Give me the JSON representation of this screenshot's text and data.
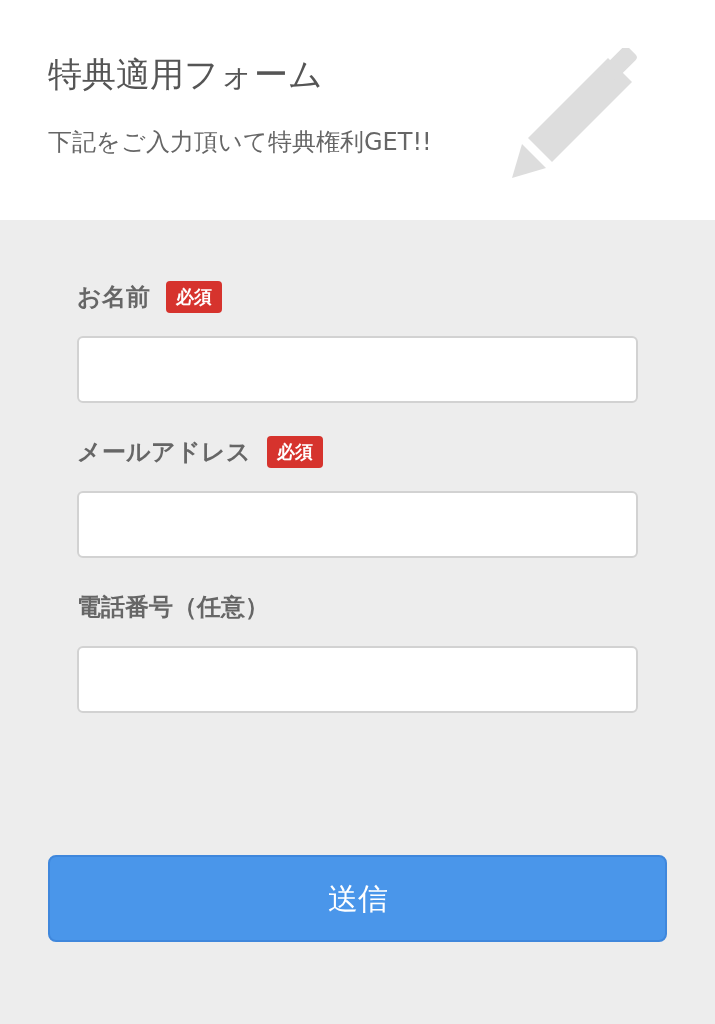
{
  "header": {
    "title": "特典適用フォーム",
    "subtitle": "下記をご入力頂いて特典権利GET!!"
  },
  "fields": [
    {
      "label": "お名前",
      "badge": "必須"
    },
    {
      "label": "メールアドレス",
      "badge": "必須"
    },
    {
      "label": "電話番号（任意）"
    }
  ],
  "submit": "送信"
}
